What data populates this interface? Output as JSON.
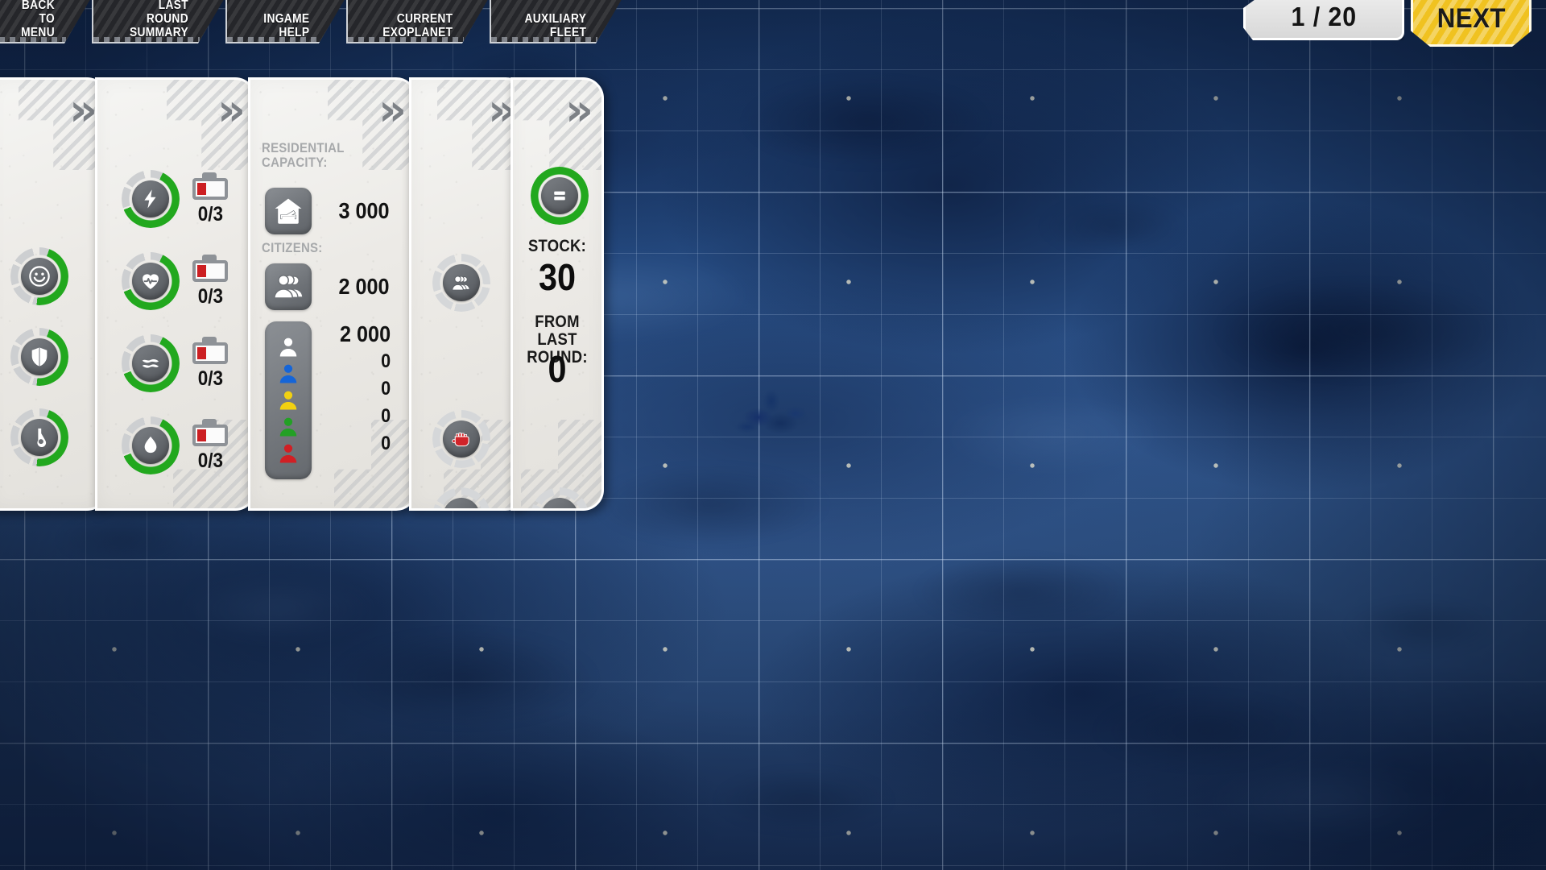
{
  "topbar": {
    "tabs": [
      {
        "id": "back-to-menu",
        "label": "BACK TO\nMENU"
      },
      {
        "id": "last-round-summary",
        "label": "LAST ROUND\nSUMMARY"
      },
      {
        "id": "ingame-help",
        "label": "INGAME\nHELP"
      },
      {
        "id": "current-exoplanet",
        "label": "CURRENT\nEXOPLANET"
      },
      {
        "id": "auxiliary-fleet",
        "label": "AUXILIARY\nFLEET"
      }
    ],
    "round_counter": "1 / 20",
    "next_label": "NEXT"
  },
  "colors": {
    "accent_green": "#22a81e",
    "accent_yellow": "#f0c220",
    "battery_red": "#cc1f22",
    "panel_light": "#f0eeea",
    "tab_dark": "#25262a",
    "grid_blue": "#2e5389"
  },
  "status_panel": {
    "indicators": [
      {
        "id": "happiness",
        "icon": "smiley-icon",
        "fill_percent": 46
      },
      {
        "id": "security",
        "icon": "shield-icon",
        "fill_percent": 46
      },
      {
        "id": "research",
        "icon": "research-icon",
        "fill_percent": 46
      }
    ]
  },
  "resources_panel": {
    "rows": [
      {
        "id": "energy",
        "icon": "lightning-icon",
        "fill_percent": 62,
        "ratio": "0/3"
      },
      {
        "id": "health",
        "icon": "heartbeat-icon",
        "fill_percent": 62,
        "ratio": "0/3"
      },
      {
        "id": "air",
        "icon": "air-waves-icon",
        "fill_percent": 62,
        "ratio": "0/3"
      },
      {
        "id": "water",
        "icon": "water-drop-icon",
        "fill_percent": 62,
        "ratio": "0/3"
      }
    ]
  },
  "population_panel": {
    "residential_capacity_label": "RESIDENTIAL\nCAPACITY:",
    "residential_capacity_value": "3 000",
    "residential_capacity_icon": "house-bed-icon",
    "citizens_label": "CITIZENS:",
    "citizens_value": "2 000",
    "citizens_icon": "citizens-group-icon",
    "citizen_classes": [
      {
        "id": "class-white",
        "color": "#ffffff",
        "value": "2 000"
      },
      {
        "id": "class-blue",
        "color": "#1565d8",
        "value": "0"
      },
      {
        "id": "class-yellow",
        "color": "#f2d111",
        "value": "0"
      },
      {
        "id": "class-green",
        "color": "#23a025",
        "value": "0"
      },
      {
        "id": "class-red",
        "color": "#d11f24",
        "value": "0"
      }
    ]
  },
  "factions_panel": {
    "items": [
      {
        "id": "population",
        "icon": "citizens-group-icon"
      },
      {
        "id": "rebellion",
        "icon": "red-fist-icon"
      },
      {
        "id": "federation",
        "icon": "winged-emblem-icon"
      }
    ]
  },
  "stock_panel": {
    "top_icon": "stock-crate-icon",
    "top_fill_percent": 100,
    "stock_label": "STOCK:",
    "stock_value": "30",
    "from_last_round_label": "FROM LAST\nROUND:",
    "from_last_round_value": "0",
    "bottom_icon": "bricks-icon"
  }
}
